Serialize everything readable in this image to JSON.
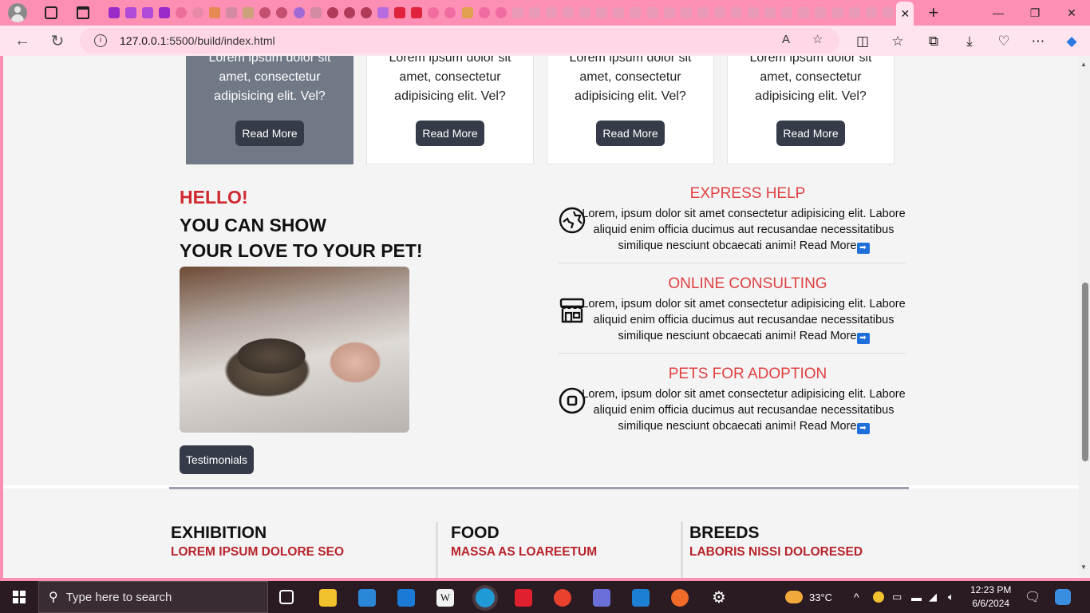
{
  "browser": {
    "url_host": "127.0.0.1",
    "url_path": ":5500/build/index.html",
    "active_tab_close": "✕",
    "new_tab": "+",
    "win_min": "—",
    "win_max": "❐",
    "win_close": "✕",
    "reader_label": "A"
  },
  "cards": [
    {
      "text": "Lorem ipsum dolor sit amet, consectetur adipisicing elit. Vel?",
      "button": "Read More"
    },
    {
      "text": "Lorem ipsum dolor sit amet, consectetur adipisicing elit. Vel?",
      "button": "Read More"
    },
    {
      "text": "Lorem ipsum dolor sit amet, consectetur adipisicing elit. Vel?",
      "button": "Read More"
    },
    {
      "text": "Lorem ipsum dolor sit amet, consectetur adipisicing elit. Vel?",
      "button": "Read More"
    }
  ],
  "hero": {
    "hello": "HELLO!",
    "line1": "YOU CAN SHOW",
    "line2": "YOUR LOVE TO YOUR PET!",
    "button": "Testimonials"
  },
  "features": [
    {
      "title": "EXPRESS HELP",
      "text": "Lorem, ipsum dolor sit amet consectetur adipisicing elit. Labore aliquid enim officia ducimus aut recusandae necessitatibus similique nesciunt obcaecati animi!",
      "link": "Read More",
      "icon": "globe-icon"
    },
    {
      "title": "ONLINE CONSULTING",
      "text": "Lorem, ipsum dolor sit amet consectetur adipisicing elit. Labore aliquid enim officia ducimus aut recusandae necessitatibus similique nesciunt obcaecati animi!",
      "link": "Read More",
      "icon": "store-icon"
    },
    {
      "title": "PETS FOR ADOPTION",
      "text": "Lorem, ipsum dolor sit amet consectetur adipisicing elit. Labore aliquid enim officia ducimus aut recusandae necessitatibus similique nesciunt obcaecati animi!",
      "link": "Read More",
      "icon": "stop-circle-icon"
    }
  ],
  "footer_cols": [
    {
      "title": "EXHIBITION",
      "subtitle": "LOREM IPSUM DOLORE SEO"
    },
    {
      "title": "FOOD",
      "subtitle": "MASSA AS LOAREETUM"
    },
    {
      "title": "BREEDS",
      "subtitle": "LABORIS NISSI DOLORESED"
    }
  ],
  "taskbar": {
    "search_placeholder": "Type here to search",
    "weather": "33°C",
    "time": "12:23 PM",
    "date": "6/6/2024"
  },
  "colors": {
    "accent_pink": "#fd8fb4",
    "title_red": "#d0282f",
    "button_dark": "#353b48"
  }
}
